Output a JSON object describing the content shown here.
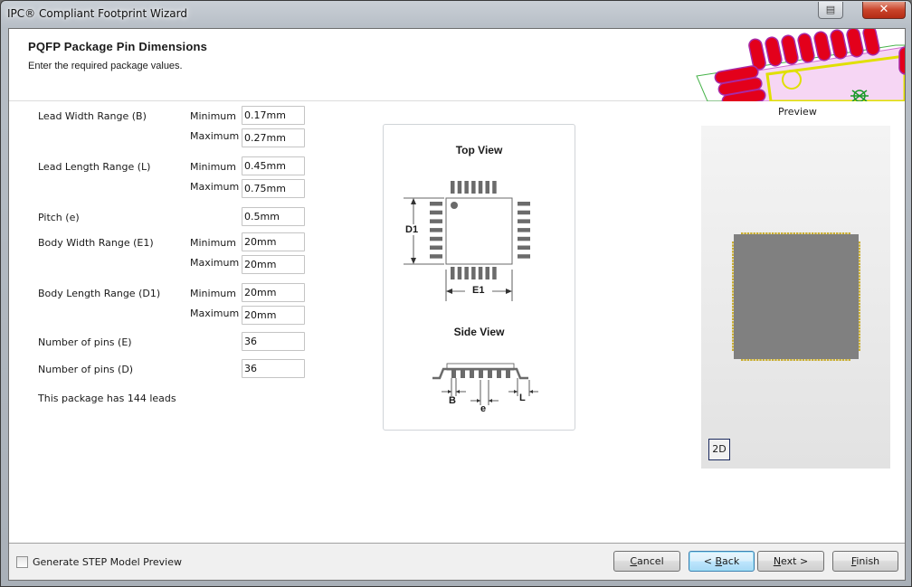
{
  "window": {
    "title": "IPC® Compliant Footprint Wizard",
    "restore_icon": "restore-window-icon",
    "close_icon": "close-icon"
  },
  "header": {
    "title": "PQFP Package Pin Dimensions",
    "subtitle": "Enter the required package values."
  },
  "form": {
    "lead_width": {
      "label": "Lead Width Range (B)",
      "min_label": "Minimum",
      "min_value": "0.17mm",
      "max_label": "Maximum",
      "max_value": "0.27mm"
    },
    "lead_length": {
      "label": "Lead Length Range (L)",
      "min_label": "Minimum",
      "min_value": "0.45mm",
      "max_label": "Maximum",
      "max_value": "0.75mm"
    },
    "pitch": {
      "label": "Pitch (e)",
      "value": "0.5mm"
    },
    "body_width": {
      "label": "Body Width Range (E1)",
      "min_label": "Minimum",
      "min_value": "20mm",
      "max_label": "Maximum",
      "max_value": "20mm"
    },
    "body_length": {
      "label": "Body Length Range (D1)",
      "min_label": "Minimum",
      "min_value": "20mm",
      "max_label": "Maximum",
      "max_value": "20mm"
    },
    "pins_e": {
      "label": "Number of pins (E)",
      "value": "36"
    },
    "pins_d": {
      "label": "Number of pins (D)",
      "value": "36"
    },
    "lead_summary": "This package has 144 leads"
  },
  "diagram": {
    "top_view_title": "Top View",
    "side_view_title": "Side View",
    "labels": {
      "d1": "D1",
      "e1": "E1",
      "b": "B",
      "e": "e",
      "l": "L"
    }
  },
  "preview": {
    "label": "Preview",
    "mode_button": "2D",
    "colors": {
      "body": "#808080",
      "pads": "#c8ac2e"
    }
  },
  "footer": {
    "step_checkbox_label": "Generate STEP Model Preview",
    "step_checked": false,
    "buttons": {
      "cancel": {
        "accel": "C",
        "rest": "ancel"
      },
      "back": {
        "prefix": "< ",
        "accel": "B",
        "rest": "ack"
      },
      "next": {
        "accel": "N",
        "rest": "ext >"
      },
      "finish": {
        "accel": "F",
        "rest": "inish"
      }
    }
  }
}
